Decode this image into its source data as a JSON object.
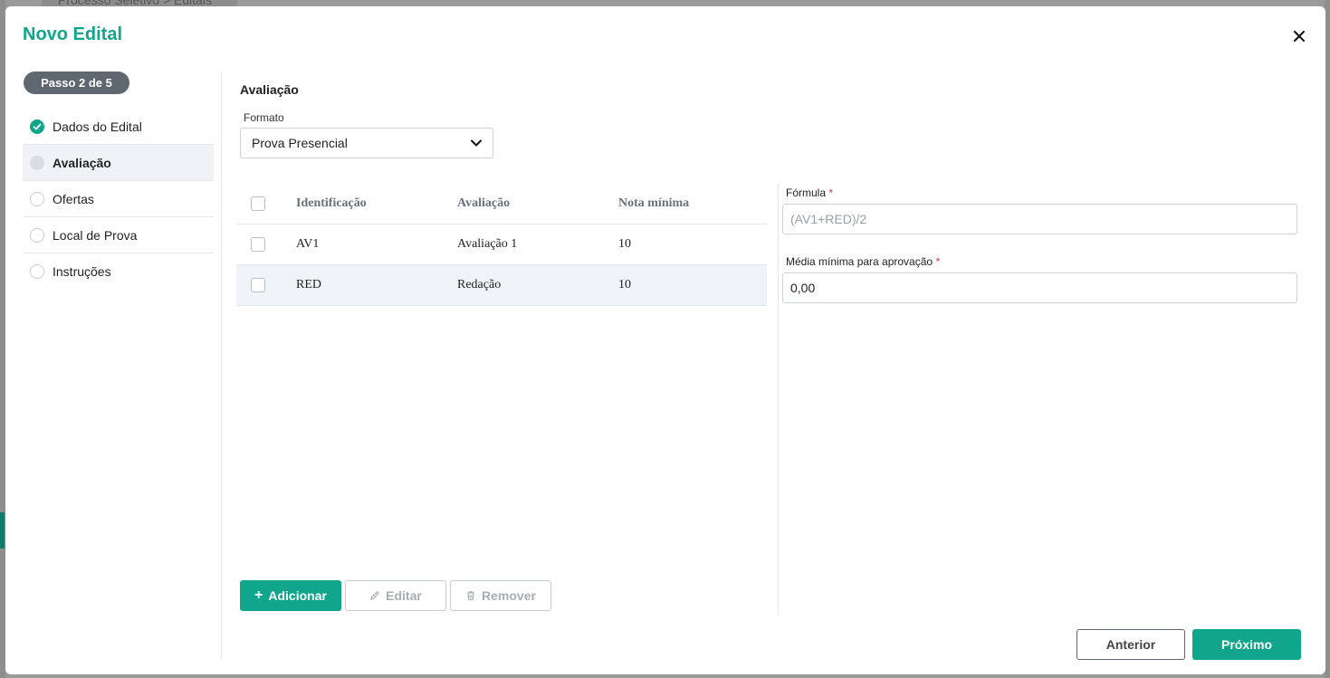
{
  "background": {
    "breadcrumb": "Processo Seletivo  >  Editais"
  },
  "modal": {
    "title": "Novo Edital",
    "close_icon": "close-icon"
  },
  "stepper": {
    "badge": "Passo 2 de 5",
    "steps": [
      {
        "label": "Dados do Edital",
        "state": "done"
      },
      {
        "label": "Avaliação",
        "state": "current"
      },
      {
        "label": "Ofertas",
        "state": "pending"
      },
      {
        "label": "Local de Prova",
        "state": "pending"
      },
      {
        "label": "Instruções",
        "state": "pending"
      }
    ]
  },
  "main": {
    "section_title": "Avaliação",
    "format_label": "Formato",
    "format_value": "Prova Presencial",
    "table": {
      "headers": [
        "Identificação",
        "Avaliação",
        "Nota mínima"
      ],
      "rows": [
        {
          "id": "AV1",
          "avaliacao": "Avaliação 1",
          "nota": "10"
        },
        {
          "id": "RED",
          "avaliacao": "Redação",
          "nota": "10"
        }
      ]
    },
    "buttons": {
      "add": "Adicionar",
      "edit": "Editar",
      "remove": "Remover"
    }
  },
  "form": {
    "formula_label": "Fórmula",
    "formula_placeholder": "(AV1+RED)/2",
    "media_label": "Média mínima para aprovação",
    "media_value": "0,00",
    "required_mark": "*"
  },
  "footer": {
    "prev": "Anterior",
    "next": "Próximo"
  },
  "colors": {
    "accent": "#0fa68c",
    "badge": "#5f6770",
    "required": "#d9363e"
  }
}
